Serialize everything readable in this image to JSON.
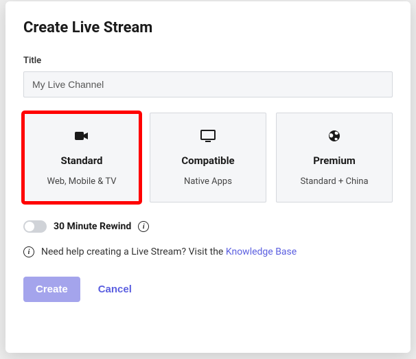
{
  "modal": {
    "title": "Create Live Stream",
    "title_field": {
      "label": "Title",
      "value": "My Live Channel"
    },
    "options": [
      {
        "icon": "video-camera-icon",
        "title": "Standard",
        "desc": "Web, Mobile & TV",
        "selected": true
      },
      {
        "icon": "monitor-icon",
        "title": "Compatible",
        "desc": "Native Apps",
        "selected": false
      },
      {
        "icon": "globe-icon",
        "title": "Premium",
        "desc": "Standard + China",
        "selected": false
      }
    ],
    "rewind": {
      "label": "30 Minute Rewind",
      "enabled": false
    },
    "help": {
      "text": "Need help creating a Live Stream? Visit the ",
      "link_text": "Knowledge Base"
    },
    "actions": {
      "create": "Create",
      "cancel": "Cancel"
    }
  }
}
